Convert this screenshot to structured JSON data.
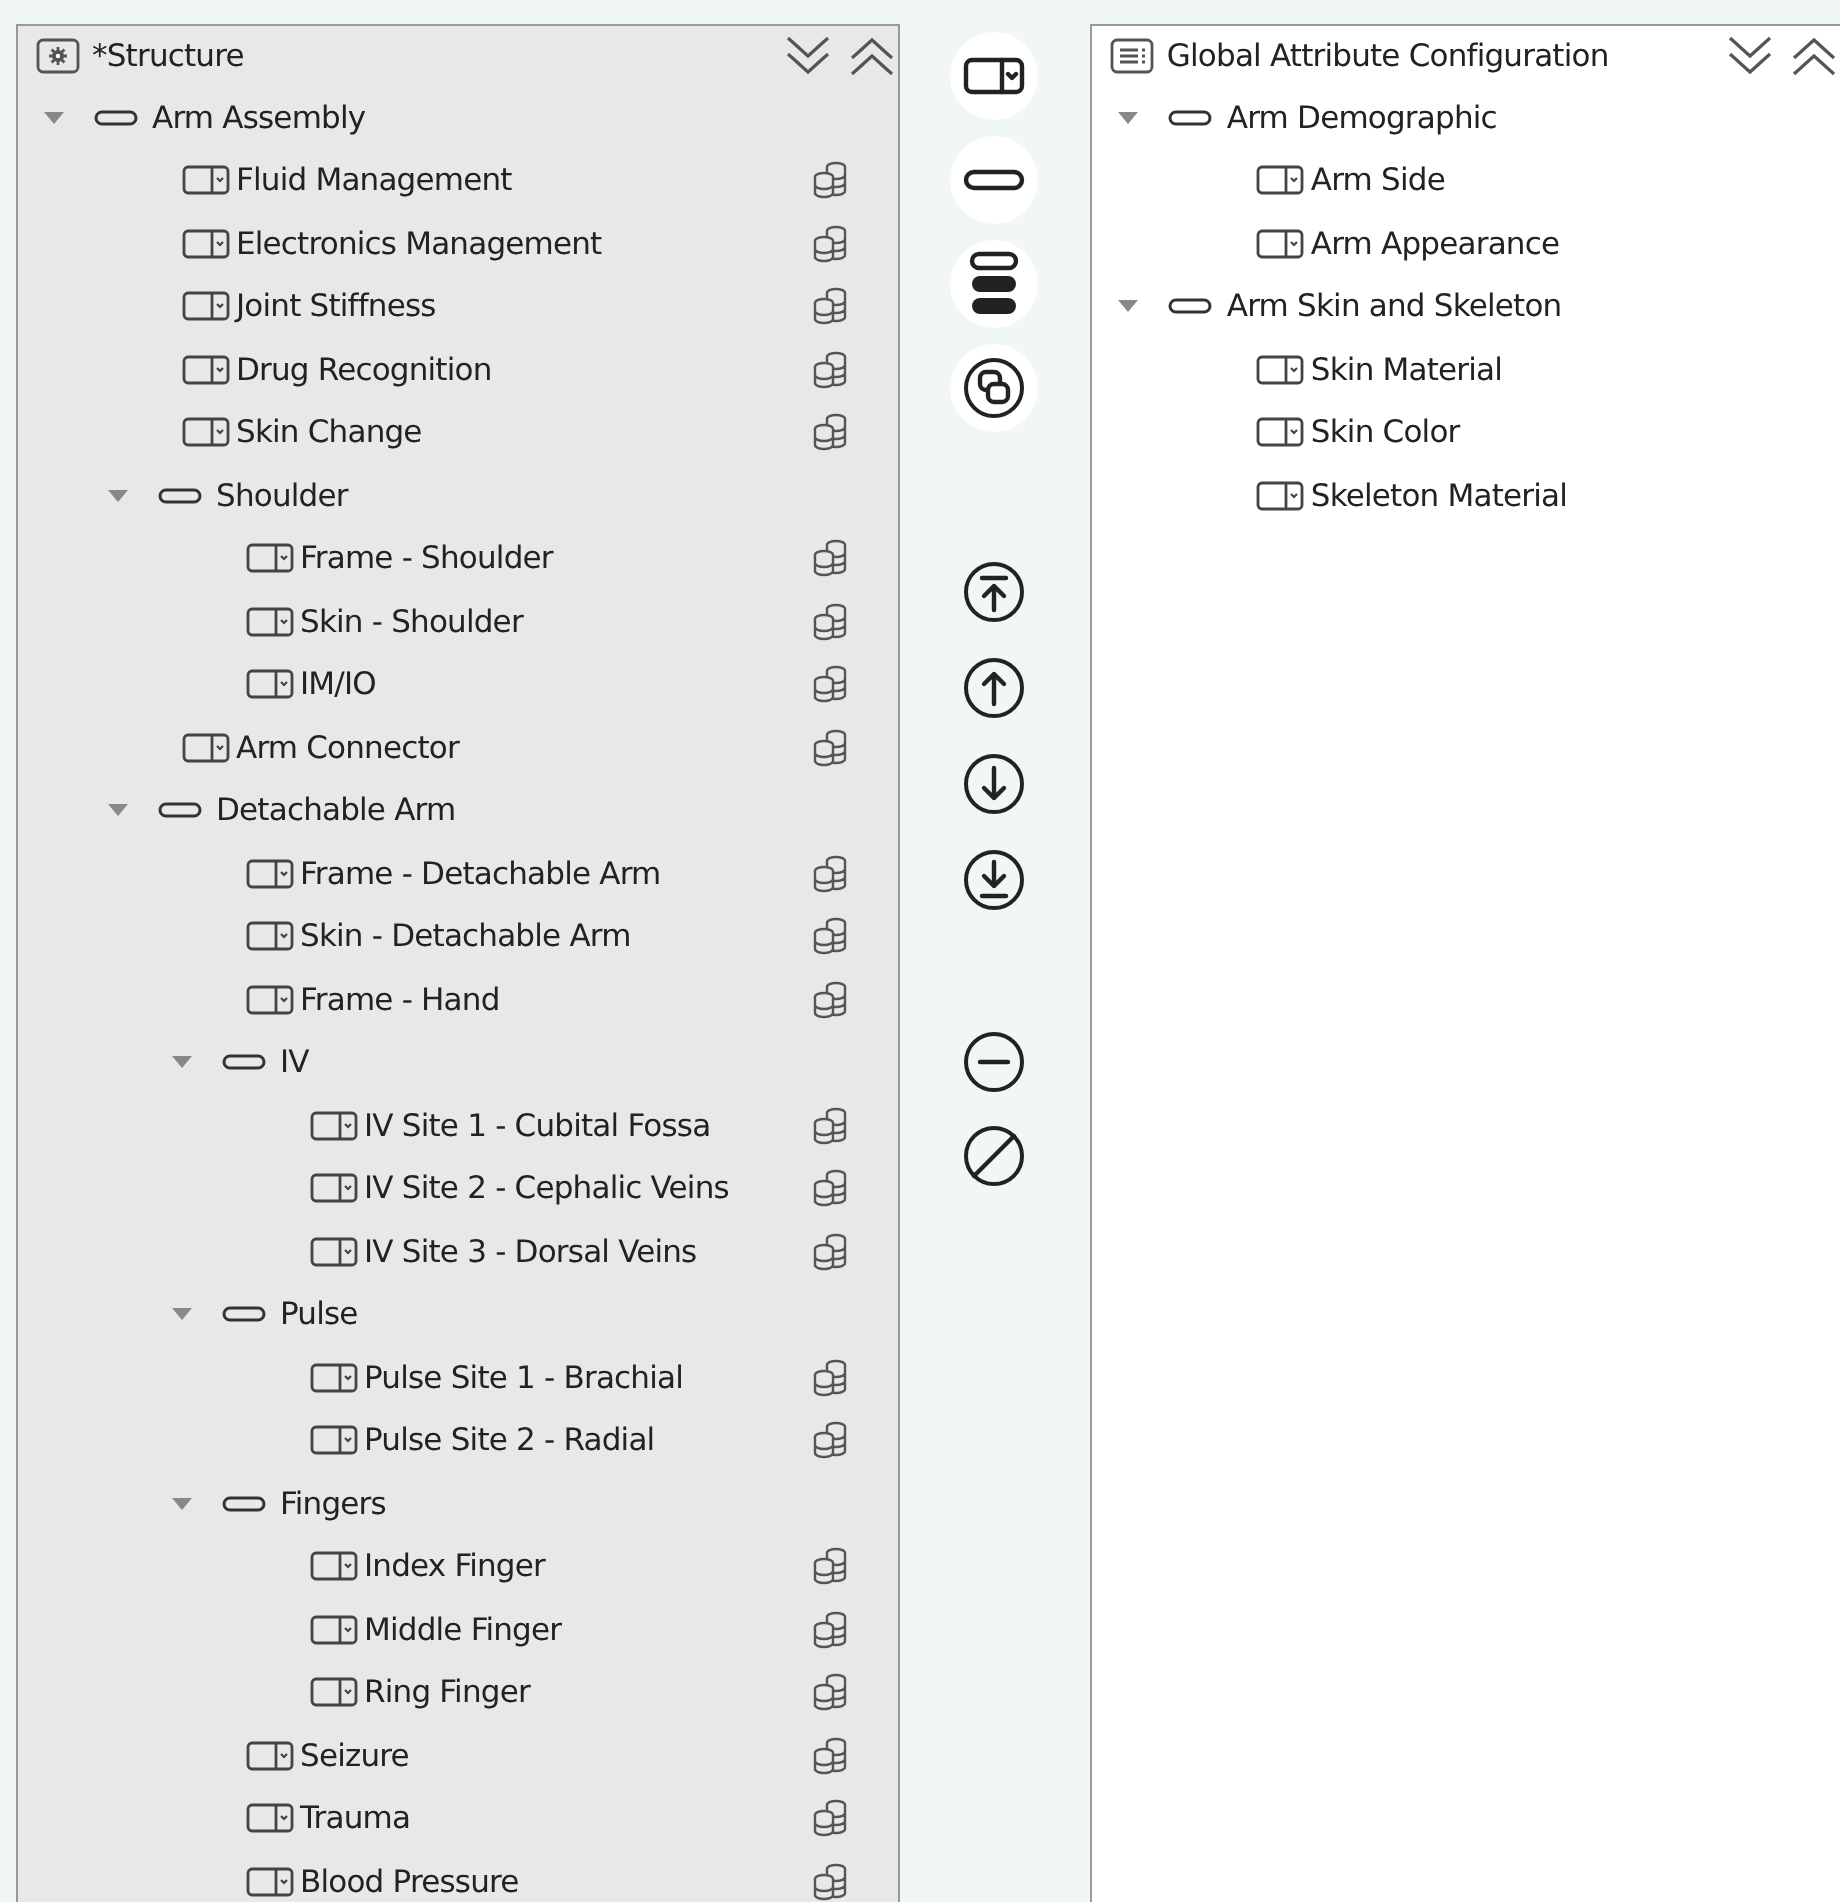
{
  "structure_panel": {
    "title": "*Structure",
    "tree": [
      {
        "kind": "group",
        "label": "Arm Assembly",
        "expanded": true,
        "children": [
          {
            "kind": "attribute",
            "label": "Fluid Management"
          },
          {
            "kind": "attribute",
            "label": "Electronics Management"
          },
          {
            "kind": "attribute",
            "label": "Joint Stiffness"
          },
          {
            "kind": "attribute",
            "label": "Drug Recognition"
          },
          {
            "kind": "attribute",
            "label": "Skin Change"
          },
          {
            "kind": "group",
            "label": "Shoulder",
            "expanded": true,
            "children": [
              {
                "kind": "attribute",
                "label": "Frame - Shoulder"
              },
              {
                "kind": "attribute",
                "label": "Skin - Shoulder"
              },
              {
                "kind": "attribute",
                "label": "IM/IO"
              }
            ]
          },
          {
            "kind": "attribute",
            "label": "Arm Connector"
          },
          {
            "kind": "group",
            "label": "Detachable Arm",
            "expanded": true,
            "children": [
              {
                "kind": "attribute",
                "label": "Frame - Detachable Arm"
              },
              {
                "kind": "attribute",
                "label": "Skin - Detachable Arm"
              },
              {
                "kind": "attribute",
                "label": "Frame - Hand"
              },
              {
                "kind": "group",
                "label": "IV",
                "expanded": true,
                "children": [
                  {
                    "kind": "attribute",
                    "label": "IV Site 1 - Cubital Fossa"
                  },
                  {
                    "kind": "attribute",
                    "label": "IV Site 2 - Cephalic Veins"
                  },
                  {
                    "kind": "attribute",
                    "label": "IV Site 3 - Dorsal Veins"
                  }
                ]
              },
              {
                "kind": "group",
                "label": "Pulse",
                "expanded": true,
                "children": [
                  {
                    "kind": "attribute",
                    "label": "Pulse Site 1 - Brachial"
                  },
                  {
                    "kind": "attribute",
                    "label": "Pulse Site 2 - Radial"
                  }
                ]
              },
              {
                "kind": "group",
                "label": "Fingers",
                "expanded": true,
                "children": [
                  {
                    "kind": "attribute",
                    "label": "Index Finger"
                  },
                  {
                    "kind": "attribute",
                    "label": "Middle Finger"
                  },
                  {
                    "kind": "attribute",
                    "label": "Ring Finger"
                  }
                ]
              },
              {
                "kind": "attribute",
                "label": "Seizure"
              },
              {
                "kind": "attribute",
                "label": "Trauma"
              },
              {
                "kind": "attribute",
                "label": "Blood Pressure"
              }
            ]
          }
        ]
      }
    ]
  },
  "global_panel": {
    "title": "Global Attribute Configuration",
    "tree": [
      {
        "kind": "group",
        "label": "Arm Demographic",
        "expanded": true,
        "children": [
          {
            "kind": "attribute",
            "label": "Arm Side"
          },
          {
            "kind": "attribute",
            "label": "Arm Appearance"
          }
        ]
      },
      {
        "kind": "group",
        "label": "Arm Skin and Skeleton",
        "expanded": true,
        "children": [
          {
            "kind": "attribute",
            "label": "Skin Material"
          },
          {
            "kind": "attribute",
            "label": "Skin Color"
          },
          {
            "kind": "attribute",
            "label": "Skeleton Material"
          }
        ]
      }
    ]
  }
}
